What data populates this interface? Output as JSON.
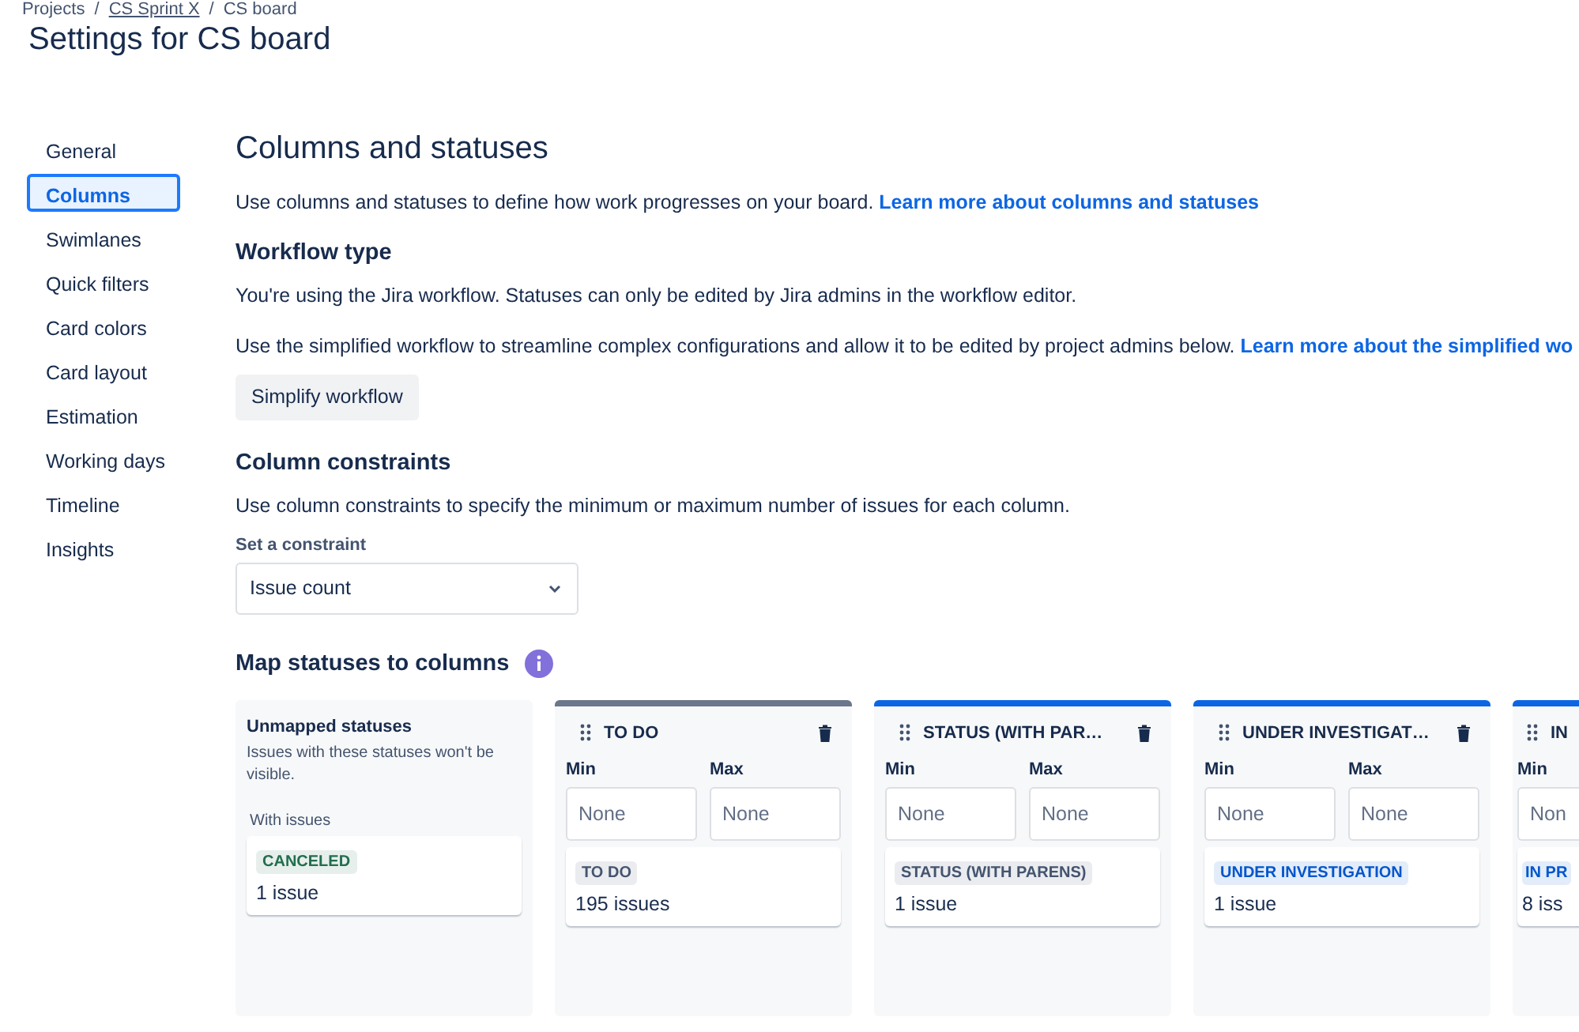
{
  "breadcrumbs": [
    {
      "kind": "text",
      "label": "Projects"
    },
    {
      "kind": "separator",
      "label": "/"
    },
    {
      "kind": "link",
      "label": "CS Sprint X"
    },
    {
      "kind": "separator",
      "label": "/"
    },
    {
      "kind": "text",
      "label": "CS board"
    }
  ],
  "page_title": "Settings for CS board",
  "sidebar": {
    "items": [
      {
        "label": "General",
        "selected": false
      },
      {
        "label": "Columns",
        "selected": true
      },
      {
        "label": "Swimlanes",
        "selected": false
      },
      {
        "label": "Quick filters",
        "selected": false
      },
      {
        "label": "Card colors",
        "selected": false
      },
      {
        "label": "Card layout",
        "selected": false
      },
      {
        "label": "Estimation",
        "selected": false
      },
      {
        "label": "Working days",
        "selected": false
      },
      {
        "label": "Timeline",
        "selected": false
      },
      {
        "label": "Insights",
        "selected": false
      }
    ]
  },
  "content": {
    "title": "Columns and statuses",
    "intro": {
      "text": "Use columns and statuses to define how work progresses on your board.",
      "link": "Learn more about columns and statuses"
    },
    "workflow": {
      "heading": "Workflow type",
      "note": "You're using the Jira workflow. Statuses can only be edited by Jira admins in the workflow editor.",
      "simplify_text": "Use the simplified workflow to streamline complex configurations and allow it to be edited by project admins below.",
      "simplify_link": "Learn more about the simplified wo",
      "button": "Simplify workflow"
    },
    "constraints": {
      "heading": "Column constraints",
      "text": "Use column constraints to specify the minimum or maximum number of issues for each column.",
      "label": "Set a constraint",
      "value": "Issue count"
    },
    "map": {
      "heading": "Map statuses to columns",
      "unmapped": {
        "title": "Unmapped statuses",
        "text": "Issues with these statuses won't be visible.",
        "group": "With issues",
        "statuses": [
          {
            "name": "CANCELED",
            "color": "#216e4e",
            "count": "1 issue"
          }
        ]
      },
      "columns": [
        {
          "title": "TO DO",
          "color": "#6b778c",
          "fields": [
            {
              "label": "Min",
              "placeholder": "None"
            },
            {
              "label": "Max",
              "placeholder": "None"
            }
          ],
          "statuses": [
            {
              "name": "TO DO",
              "color": "#44546f",
              "count": "195 issues"
            }
          ]
        },
        {
          "title": "STATUS (WITH PAR…",
          "color": "#0c66e4",
          "fields": [
            {
              "label": "Min",
              "placeholder": "None"
            },
            {
              "label": "Max",
              "placeholder": "None"
            }
          ],
          "statuses": [
            {
              "name": "STATUS (WITH PARENS)",
              "color": "#44546f",
              "count": "1 issue"
            }
          ]
        },
        {
          "title": "UNDER INVESTIGAT…",
          "color": "#0c66e4",
          "fields": [
            {
              "label": "Min",
              "placeholder": "None"
            },
            {
              "label": "Max",
              "placeholder": "None"
            }
          ],
          "statuses": [
            {
              "name": "UNDER INVESTIGATION",
              "color": "#0055cc",
              "count": "1 issue"
            }
          ]
        },
        {
          "title": "IN",
          "color": "#0c66e4",
          "fields": [
            {
              "label": "Min",
              "placeholder": "Non"
            }
          ],
          "statuses": [
            {
              "name": "IN PR",
              "color": "#0055cc",
              "count": "8 iss"
            }
          ]
        }
      ]
    }
  }
}
